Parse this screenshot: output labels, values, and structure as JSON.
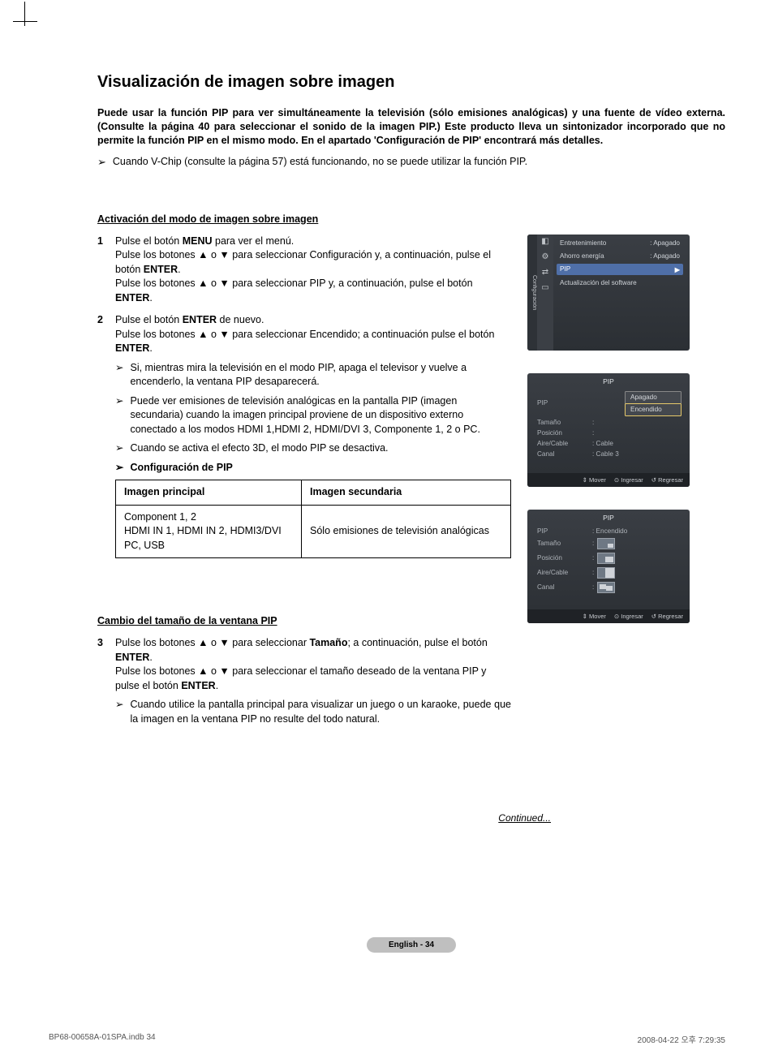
{
  "title": "Visualización de imagen sobre imagen",
  "intro": "Puede usar la función PIP para ver simultáneamente la televisión (sólo emisiones analógicas) y una fuente de vídeo externa. (Consulte la página 40 para seleccionar el sonido de la imagen PIP.) Este producto lleva un sintonizador incorporado que no permite la función PIP en el mismo modo. En el apartado 'Configuración de PIP' encontrará más detalles.",
  "top_note": "Cuando V-Chip (consulte la página 57) está funcionando, no se puede utilizar la función PIP.",
  "section1": "Activación del modo de imagen sobre imagen",
  "step1": {
    "num": "1",
    "l1a": "Pulse el botón ",
    "l1b": "MENU",
    "l1c": " para ver el menú.",
    "l2": "Pulse los botones ▲ o ▼ para seleccionar Configuración y, a continuación, pulse el botón ",
    "l2b": "ENTER",
    "l2c": ".",
    "l3": "Pulse los botones ▲ o ▼ para seleccionar PIP y, a continuación, pulse el botón ",
    "l3b": "ENTER",
    "l3c": "."
  },
  "step2": {
    "num": "2",
    "l1a": "Pulse el botón ",
    "l1b": "ENTER",
    "l1c": " de nuevo.",
    "l2": "Pulse los botones ▲ o ▼ para seleccionar Encendido; a continuación pulse el botón ",
    "l2b": "ENTER",
    "l2c": ".",
    "s1": "Si, mientras mira la televisión en el modo PIP, apaga el televisor y vuelve a encenderlo, la ventana PIP desaparecerá.",
    "s2": "Puede ver emisiones de televisión analógicas en la pantalla PIP (imagen secundaria) cuando la imagen principal proviene de un dispositivo externo conectado a los modos HDMI 1,HDMI 2, HDMI/DVI 3, Componente 1, 2 o PC.",
    "s3": "Cuando se activa el efecto 3D, el modo PIP se desactiva.",
    "s4": "Configuración de PIP"
  },
  "table": {
    "h1": "Imagen principal",
    "h2": "Imagen secundaria",
    "c1": "Component 1, 2\nHDMI IN 1, HDMI IN 2, HDMI3/DVI\nPC, USB",
    "c2": "Sólo emisiones de televisión analógicas"
  },
  "section2": "Cambio del tamaño de la ventana PIP",
  "step3": {
    "num": "3",
    "l1a": "Pulse los botones ▲ o ▼ para seleccionar ",
    "l1b": "Tamaño",
    "l1c": "; a continuación, pulse el botón ",
    "l1d": "ENTER",
    "l1e": ".",
    "l2": "Pulse los botones ▲ o ▼ para seleccionar el tamaño deseado de la ventana PIP y pulse el botón ",
    "l2b": "ENTER",
    "l2c": ".",
    "s1": "Cuando utilice la pantalla principal para visualizar un juego o un karaoke, puede que la imagen en la ventana PIP no resulte del todo natural."
  },
  "continued": "Continued...",
  "badge": "English - 34",
  "footer": {
    "left": "BP68-00658A-01SPA.indb   34",
    "right": "2008-04-22   오후 7:29:35"
  },
  "osd1": {
    "tab": "Configuración",
    "rows": [
      {
        "l": "Entretenimiento",
        "v": ": Apagado"
      },
      {
        "l": "Ahorro energía",
        "v": ": Apagado"
      },
      {
        "l": "PIP",
        "v": "",
        "hl": true
      },
      {
        "l": "Actualización del software",
        "v": ""
      }
    ]
  },
  "osd2": {
    "title": "PIP",
    "rows": [
      {
        "l": "PIP"
      },
      {
        "l": "Tamaño",
        "v": ":"
      },
      {
        "l": "Posición",
        "v": ":"
      },
      {
        "l": "Aire/Cable",
        "v": ": Cable"
      },
      {
        "l": "Canal",
        "v": ": Cable 3"
      }
    ],
    "drop": [
      "Apagado",
      "Encendido"
    ],
    "foot": [
      "Mover",
      "Ingresar",
      "Regresar"
    ]
  },
  "osd3": {
    "title": "PIP",
    "rows": [
      {
        "l": "PIP",
        "v": ": Encendido"
      },
      {
        "l": "Tamaño",
        "v": ":"
      },
      {
        "l": "Posición",
        "v": ":"
      },
      {
        "l": "Aire/Cable",
        "v": ":"
      },
      {
        "l": "Canal",
        "v": ":"
      }
    ],
    "foot": [
      "Mover",
      "Ingresar",
      "Regresar"
    ]
  }
}
